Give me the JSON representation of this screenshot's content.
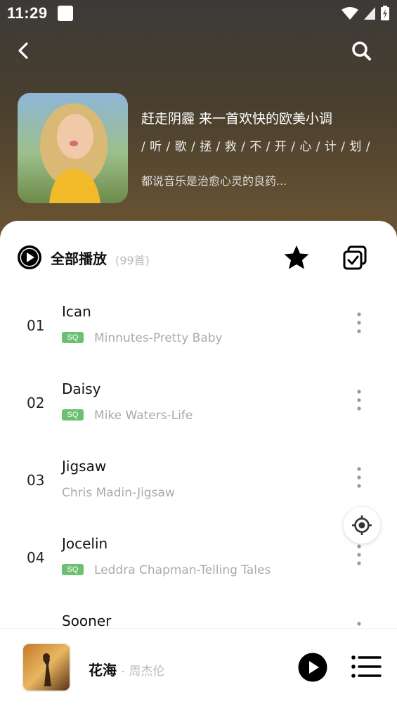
{
  "status": {
    "time": "11:29"
  },
  "playlist": {
    "title": "赶走阴霾 来一首欢快的欧美小调",
    "tags": "/ 听 / 歌 / 拯 / 救 / 不 / 开 / 心 / 计 / 划 /",
    "description": "都说音乐是治愈心灵的良药..."
  },
  "toolbar": {
    "play_all": "全部播放",
    "count": "(99首)"
  },
  "songs": [
    {
      "index": "01",
      "title": "Ican",
      "sq": "SQ",
      "artist": "Minnutes-Pretty Baby"
    },
    {
      "index": "02",
      "title": "Daisy",
      "sq": "SQ",
      "artist": "Mike Waters-Life"
    },
    {
      "index": "03",
      "title": "Jigsaw",
      "sq": "",
      "artist": "Chris Madin-Jigsaw"
    },
    {
      "index": "04",
      "title": "Jocelin",
      "sq": "SQ",
      "artist": "Leddra Chapman-Telling Tales"
    },
    {
      "index": "",
      "title": "Sooner",
      "sq": "",
      "artist": ""
    }
  ],
  "player": {
    "title": "花海",
    "artist": "- 周杰伦"
  },
  "colors": {
    "accent": "#000000",
    "sq_badge": "#6cc071",
    "hero": "#4a3f2e"
  },
  "icons": [
    "back-icon",
    "search-icon",
    "play-circle-icon",
    "star-icon",
    "multi-select-icon",
    "more-vert-icon",
    "locate-icon",
    "play-icon",
    "playlist-icon"
  ]
}
